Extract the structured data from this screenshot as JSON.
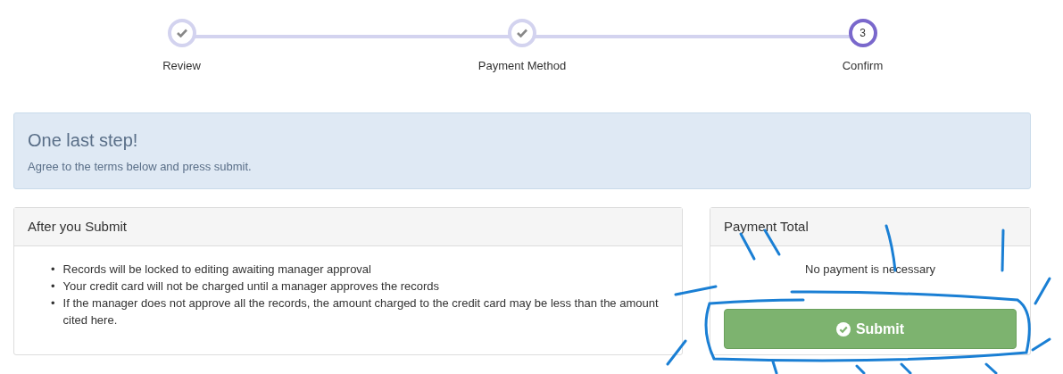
{
  "steps": [
    {
      "label": "Review",
      "completed": true,
      "selected": false
    },
    {
      "label": "Payment Method",
      "completed": true,
      "selected": false
    },
    {
      "label": "Confirm",
      "completed": false,
      "selected": true,
      "number": "3"
    }
  ],
  "alert": {
    "title": "One last step!",
    "text": "Agree to the terms below and press submit."
  },
  "after_submit": {
    "title": "After you Submit",
    "items": [
      {
        "bullet": "•",
        "text": "Records will be locked to editing awaiting manager approval"
      },
      {
        "bullet": "•",
        "text": "Your credit card will not be charged until a manager approves the records"
      },
      {
        "bullet": "•",
        "text": "If the manager does not approve all the records, the amount charged to the credit card may be less than the amount cited here."
      }
    ]
  },
  "payment_total": {
    "title": "Payment Total",
    "message": "No payment is necessary",
    "button": "Submit"
  }
}
